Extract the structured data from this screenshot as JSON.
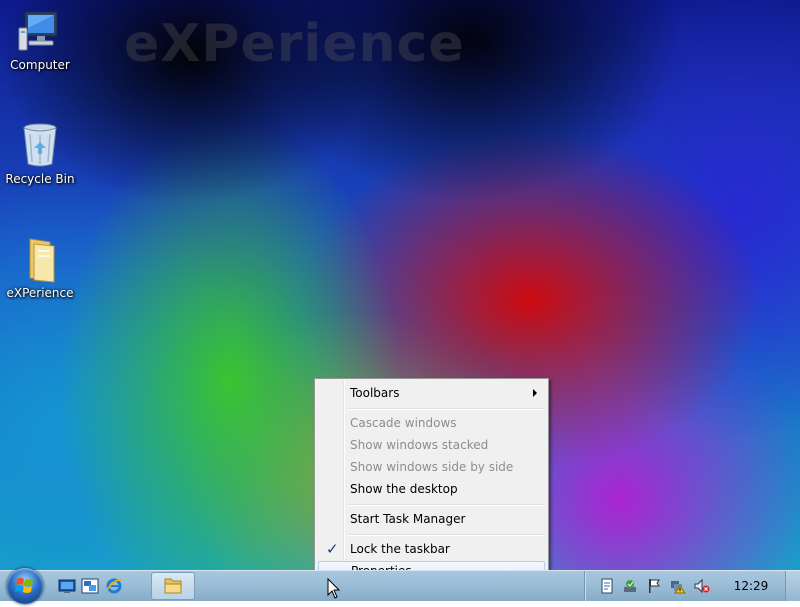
{
  "desktop": {
    "watermark": "eXPerience",
    "icons": [
      {
        "label": "Computer",
        "icon": "computer-icon"
      },
      {
        "label": "Recycle Bin",
        "icon": "recycle-bin-icon"
      },
      {
        "label": "eXPerience",
        "icon": "folder-icon"
      }
    ]
  },
  "context_menu": {
    "items": [
      {
        "label": "Toolbars",
        "enabled": true,
        "submenu": true
      },
      {
        "label": "Cascade windows",
        "enabled": false
      },
      {
        "label": "Show windows stacked",
        "enabled": false
      },
      {
        "label": "Show windows side by side",
        "enabled": false
      },
      {
        "label": "Show the desktop",
        "enabled": true
      },
      {
        "label": "Start Task Manager",
        "enabled": true
      },
      {
        "label": "Lock the taskbar",
        "enabled": true,
        "checked": true
      },
      {
        "label": "Properties",
        "enabled": true,
        "highlighted": true
      }
    ]
  },
  "taskbar": {
    "start_icon": "windows-start-orb-icon",
    "quick_launch": [
      "show-desktop-icon",
      "switch-windows-icon",
      "internet-explorer-icon"
    ],
    "tasks": [
      {
        "icon": "windows-explorer-icon",
        "active": false
      }
    ],
    "tray_icons": [
      "notepad-icon",
      "network-icon",
      "action-center-flag-icon",
      "network-warning-icon",
      "volume-muted-icon"
    ],
    "clock": "12:29"
  },
  "colors": {
    "menu_bg": "#f0f0f0",
    "menu_highlight": "#dceafc",
    "taskbar": "#9dbfd8",
    "disabled_text": "#8d8d8d"
  }
}
